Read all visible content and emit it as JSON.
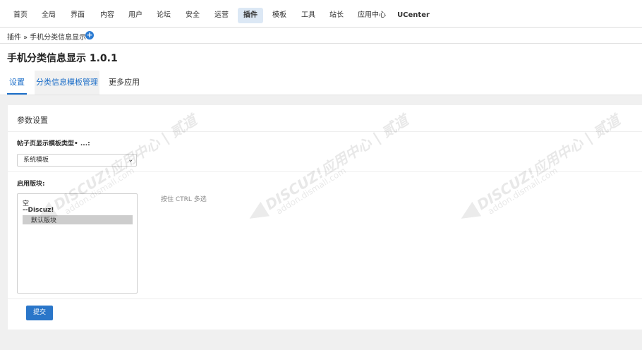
{
  "topnav": {
    "items": [
      {
        "label": "首页"
      },
      {
        "label": "全局"
      },
      {
        "label": "界面"
      },
      {
        "label": "内容"
      },
      {
        "label": "用户"
      },
      {
        "label": "论坛"
      },
      {
        "label": "安全"
      },
      {
        "label": "运营"
      },
      {
        "label": "插件",
        "active": true
      },
      {
        "label": "模板"
      },
      {
        "label": "工具"
      },
      {
        "label": "站长"
      },
      {
        "label": "应用中心"
      },
      {
        "label": "UCenter"
      }
    ]
  },
  "breadcrumb": {
    "root": "插件",
    "separator": "»",
    "current": "手机分类信息显示",
    "add_icon": "plus-icon"
  },
  "page": {
    "title": "手机分类信息显示 1.0.1"
  },
  "subtabs": [
    {
      "label": "设置",
      "state": "active"
    },
    {
      "label": "分类信息模板管理",
      "state": "hover"
    },
    {
      "label": "更多应用",
      "state": "normal"
    }
  ],
  "settings": {
    "section_title": "参数设置",
    "template_label": "帖子页显示模板类型• ...:",
    "template_select_value": "系统模板",
    "forums_label": "启用版块:",
    "forum_options": [
      {
        "label": "空",
        "type": "option"
      },
      {
        "label": "--Discuz!",
        "type": "group"
      },
      {
        "label": "默认版块",
        "type": "option",
        "selected": true
      }
    ],
    "forums_hint": "按住 CTRL 多选",
    "submit_label": "提交"
  },
  "watermark": {
    "line1": "DISCUZ!应用中心 | 贰道",
    "line2": "addon.dismall.com"
  },
  "colors": {
    "accent": "#1a6dc8",
    "button": "#2a76c9",
    "active_nav_bg": "#dce8f5"
  }
}
